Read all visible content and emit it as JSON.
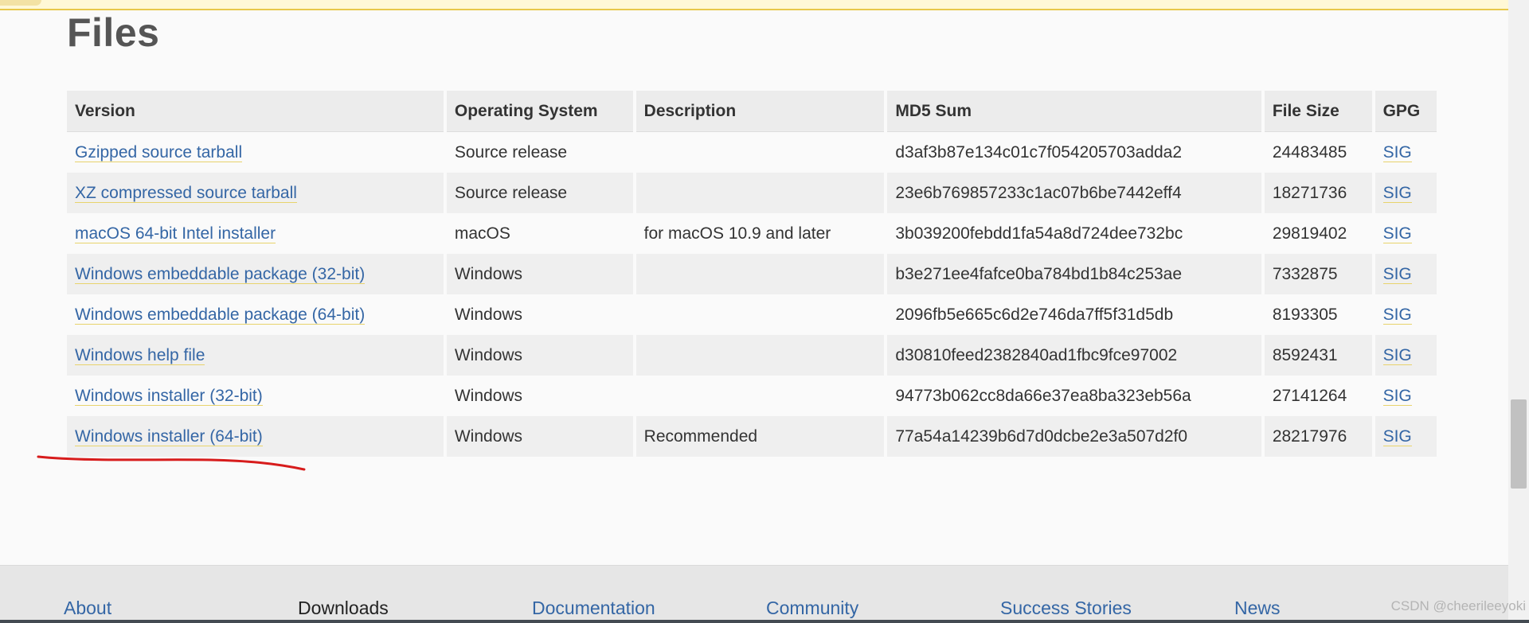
{
  "page": {
    "title": "Files"
  },
  "table": {
    "headers": {
      "version": "Version",
      "os": "Operating System",
      "description": "Description",
      "md5": "MD5 Sum",
      "size": "File Size",
      "gpg": "GPG"
    },
    "rows": [
      {
        "version": "Gzipped source tarball",
        "os": "Source release",
        "description": "",
        "md5": "d3af3b87e134c01c7f054205703adda2",
        "size": "24483485",
        "gpg": "SIG"
      },
      {
        "version": "XZ compressed source tarball",
        "os": "Source release",
        "description": "",
        "md5": "23e6b769857233c1ac07b6be7442eff4",
        "size": "18271736",
        "gpg": "SIG"
      },
      {
        "version": "macOS 64-bit Intel installer",
        "os": "macOS",
        "description": "for macOS 10.9 and later",
        "md5": "3b039200febdd1fa54a8d724dee732bc",
        "size": "29819402",
        "gpg": "SIG"
      },
      {
        "version": "Windows embeddable package (32-bit)",
        "os": "Windows",
        "description": "",
        "md5": "b3e271ee4fafce0ba784bd1b84c253ae",
        "size": "7332875",
        "gpg": "SIG"
      },
      {
        "version": "Windows embeddable package (64-bit)",
        "os": "Windows",
        "description": "",
        "md5": "2096fb5e665c6d2e746da7ff5f31d5db",
        "size": "8193305",
        "gpg": "SIG"
      },
      {
        "version": "Windows help file",
        "os": "Windows",
        "description": "",
        "md5": "d30810feed2382840ad1fbc9fce97002",
        "size": "8592431",
        "gpg": "SIG"
      },
      {
        "version": "Windows installer (32-bit)",
        "os": "Windows",
        "description": "",
        "md5": "94773b062cc8da66e37ea8ba323eb56a",
        "size": "27141264",
        "gpg": "SIG"
      },
      {
        "version": "Windows installer (64-bit)",
        "os": "Windows",
        "description": "Recommended",
        "md5": "77a54a14239b6d7d0dcbe2e3a507d2f0",
        "size": "28217976",
        "gpg": "SIG"
      }
    ]
  },
  "footer": {
    "nav": [
      {
        "label": "About",
        "current": false
      },
      {
        "label": "Downloads",
        "current": true
      },
      {
        "label": "Documentation",
        "current": false
      },
      {
        "label": "Community",
        "current": false
      },
      {
        "label": "Success Stories",
        "current": false
      },
      {
        "label": "News",
        "current": false
      }
    ]
  },
  "watermark": "CSDN @cheerileeyoki",
  "colors": {
    "link": "#3466a5",
    "link_underline": "#e8d36c",
    "annotation": "#d71c1c",
    "notify_bar": "#fff8d6"
  }
}
